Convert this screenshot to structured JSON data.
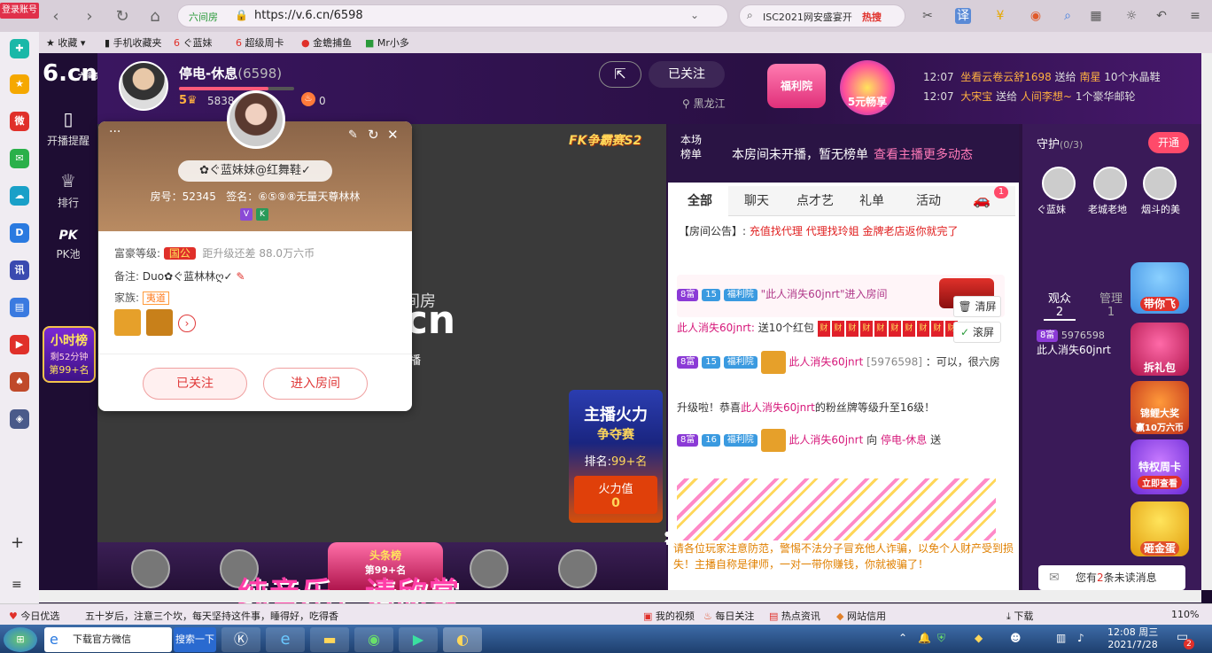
{
  "browser": {
    "login_label": "登录账号",
    "url": "https://v.6.cn/6598",
    "site_badge": "六间房",
    "search_text": "ISC2021网安盛宴开",
    "search_hot": "热搜",
    "zoom": "110%"
  },
  "bookmarks": [
    "收藏",
    "手机收藏夹",
    "ぐ蓝妹",
    "超级周卡",
    "金蟾捕鱼",
    "Mr小多"
  ],
  "site": {
    "logo": "6.cn",
    "logo_sub": "六间房"
  },
  "left_nav": {
    "items": [
      "开播提醒",
      "排行",
      "PK池"
    ],
    "hour_rank_title": "小时榜",
    "hour_rank_time": "剩52分钟",
    "hour_rank_pos": "第99+名"
  },
  "anchor": {
    "name": "停电-休息",
    "room_id": "(6598)",
    "level": "5",
    "fans": "5838",
    "hot": "0",
    "follow_state": "已关注",
    "location": "黑龙江",
    "exp_progress": 0.78
  },
  "promos": {
    "fuli": "福利院",
    "wuyuan": "5元畅享"
  },
  "gift_messages": [
    {
      "time": "12:07",
      "sender": "坐看云卷云舒1698",
      "verb": "送给",
      "receiver": "南星",
      "gift": "10个水晶鞋"
    },
    {
      "time": "12:07",
      "sender": "大宋宝",
      "verb": "送给",
      "receiver": "人间李想~",
      "gift": "1个豪华邮轮"
    }
  ],
  "video": {
    "watermark": "间房",
    "watermark2": ".cn",
    "pk_badge": "FK争霸赛S2",
    "fire_title1": "主播火力",
    "fire_title2": "争夺赛",
    "fire_rank_label": "排名:",
    "fire_rank": "99+名",
    "fire_value_label": "火力值",
    "fire_value": "0",
    "toutiao": "头条榜",
    "toutiao_sub": "第99+名",
    "broadcast_label": "播"
  },
  "subtitle": "纯音乐，请欣赏",
  "chat": {
    "rank_label": "本场\n榜单",
    "rank_empty": "本房间未开播，暂无榜单",
    "rank_more": "查看主播更多动态",
    "tabs": [
      "全部",
      "聊天",
      "点才艺",
      "礼单",
      "活动"
    ],
    "car_count": "1",
    "announce_label": "【房间公告】:",
    "announce_text": "充值找代理 代理找玲姐 金牌老店返你就完了",
    "msg1_badge1": "8富",
    "msg1_badge2": "15",
    "msg1_badge3": "福利院",
    "msg1_text": "\"此人消失60jnrt\"进入房间",
    "msg2_user": "此人消失60jnrt:",
    "msg2_text": "送10个红包",
    "msg2_red": "财",
    "btn_clear": "清屏",
    "btn_scroll": "滚屏",
    "msg3_user": "此人消失60jnrt",
    "msg3_id": "[5976598]",
    "msg3_text": "：可以，很六房",
    "msg4_prefix": "升级啦！恭喜",
    "msg4_user": "此人消失60jnrt",
    "msg4_text": "的粉丝牌等级升至16级！",
    "msg5_badge2": "16",
    "msg5_user": "此人消失60jnrt",
    "msg5_to": "向",
    "msg5_anchor": "停电-休息",
    "msg5_text": "送",
    "warning": "请各位玩家注意防范，警惕不法分子冒充他人诈骗，以免个人财产受到损失！主播自称是律师，一对一带你赚钱，你就被骗了！"
  },
  "guard": {
    "title": "守护",
    "count": "(0/3)",
    "open_btn": "开通",
    "members": [
      "ぐ蓝妹",
      "老城老地",
      "烟斗的美"
    ],
    "tab_audience": "观众",
    "audience_count": "2",
    "tab_manage": "管理",
    "manage_count": "1",
    "viewer_badge": "8富",
    "viewer_id": "5976598",
    "viewer_name": "此人消失60jnrt",
    "promo_fly": "带你飞",
    "promo_gift": "拆礼包",
    "promo_carp": "锦鲤大奖",
    "promo_carp_sub": "赢10万六币",
    "promo_week": "特权周卡",
    "promo_week_sub": "立即查看",
    "promo_egg": "砸金蛋",
    "unread_prefix": "您有",
    "unread_count": "2",
    "unread_suffix": "条未读消息"
  },
  "card": {
    "name": "✿ぐ蓝妹妹@红舞鞋✓",
    "room_label": "房号：",
    "room": "52345",
    "sign_label": "签名：",
    "sign": "⑥⑤⑨⑧无量天尊林林",
    "rich_label": "富豪等级:",
    "rich_badge": "国公",
    "rich_next": "距升级还差 88.0万六币",
    "note_label": "备注:",
    "note": "Duo✿ぐ蓝林林ღ✓",
    "family_label": "家族:",
    "family_badge": "夷道",
    "btn_followed": "已关注",
    "btn_enter": "进入房间"
  },
  "statusbar": {
    "left": [
      "今日优选",
      "五十岁后，注意三个坎，每天坚持这件事，睡得好，吃得香"
    ],
    "right": [
      "我的视频",
      "每日关注",
      "热点资讯",
      "网站信用",
      "下载"
    ],
    "zoom": "110%"
  },
  "taskbar": {
    "items": [
      "下载官方微信",
      "搜索一下"
    ],
    "time": "12:08 周三",
    "date": "2021/7/28",
    "notify_count": "2"
  },
  "colors": {
    "accent": "#e0304a",
    "purple_bg": "#2b1240",
    "chat_pink": "#d6187a"
  }
}
